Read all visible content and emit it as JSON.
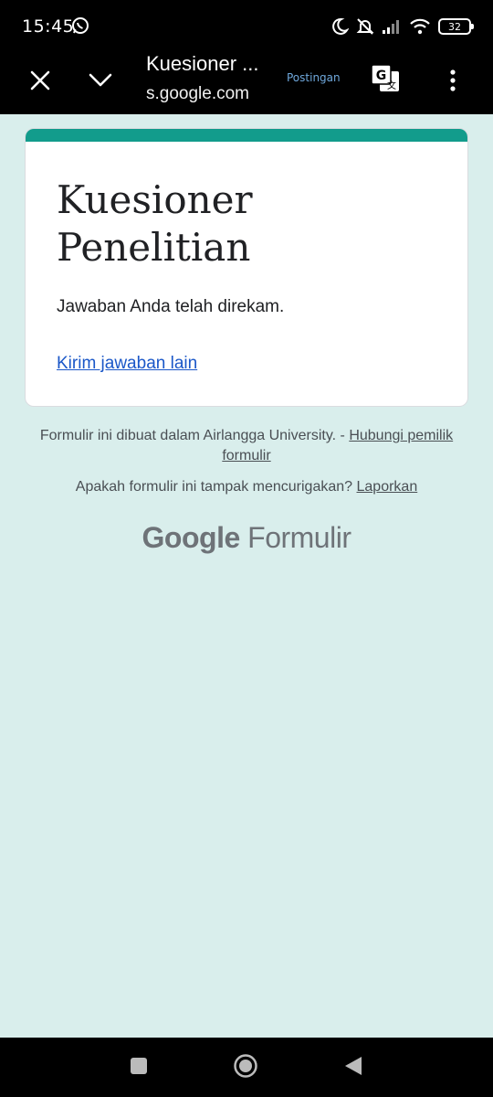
{
  "status_bar": {
    "time": "15:45",
    "battery": "32",
    "icons": [
      "whatsapp-icon",
      "moon-icon",
      "bell-off-icon",
      "signal-icon",
      "wifi-icon",
      "battery-icon"
    ]
  },
  "browser": {
    "title": "Kuesioner ...",
    "url": "s.google.com",
    "overlay_text": "Postingan",
    "icons": [
      "close-icon",
      "chevron-down-icon",
      "translate-icon",
      "more-vert-icon"
    ]
  },
  "form": {
    "title": "Kuesioner Penelitian",
    "confirmation": "Jawaban Anda telah direkam.",
    "resubmit_link": "Kirim jawaban lain",
    "accent_color": "#129c8c",
    "link_color": "#1a57c8"
  },
  "footer": {
    "created_text": "Formulir ini dibuat dalam Airlangga University. -",
    "contact_link": "Hubungi pemilik formulir",
    "suspicious_text": "Apakah formulir ini tampak mencurigakan?",
    "report_link": "Laporkan",
    "logo_google": "Google",
    "logo_product": "Formulir"
  },
  "nav_bar": {
    "icons": [
      "recents-icon",
      "home-icon",
      "back-icon"
    ]
  },
  "colors": {
    "background": "#d9eeec",
    "bars": "#000000"
  }
}
